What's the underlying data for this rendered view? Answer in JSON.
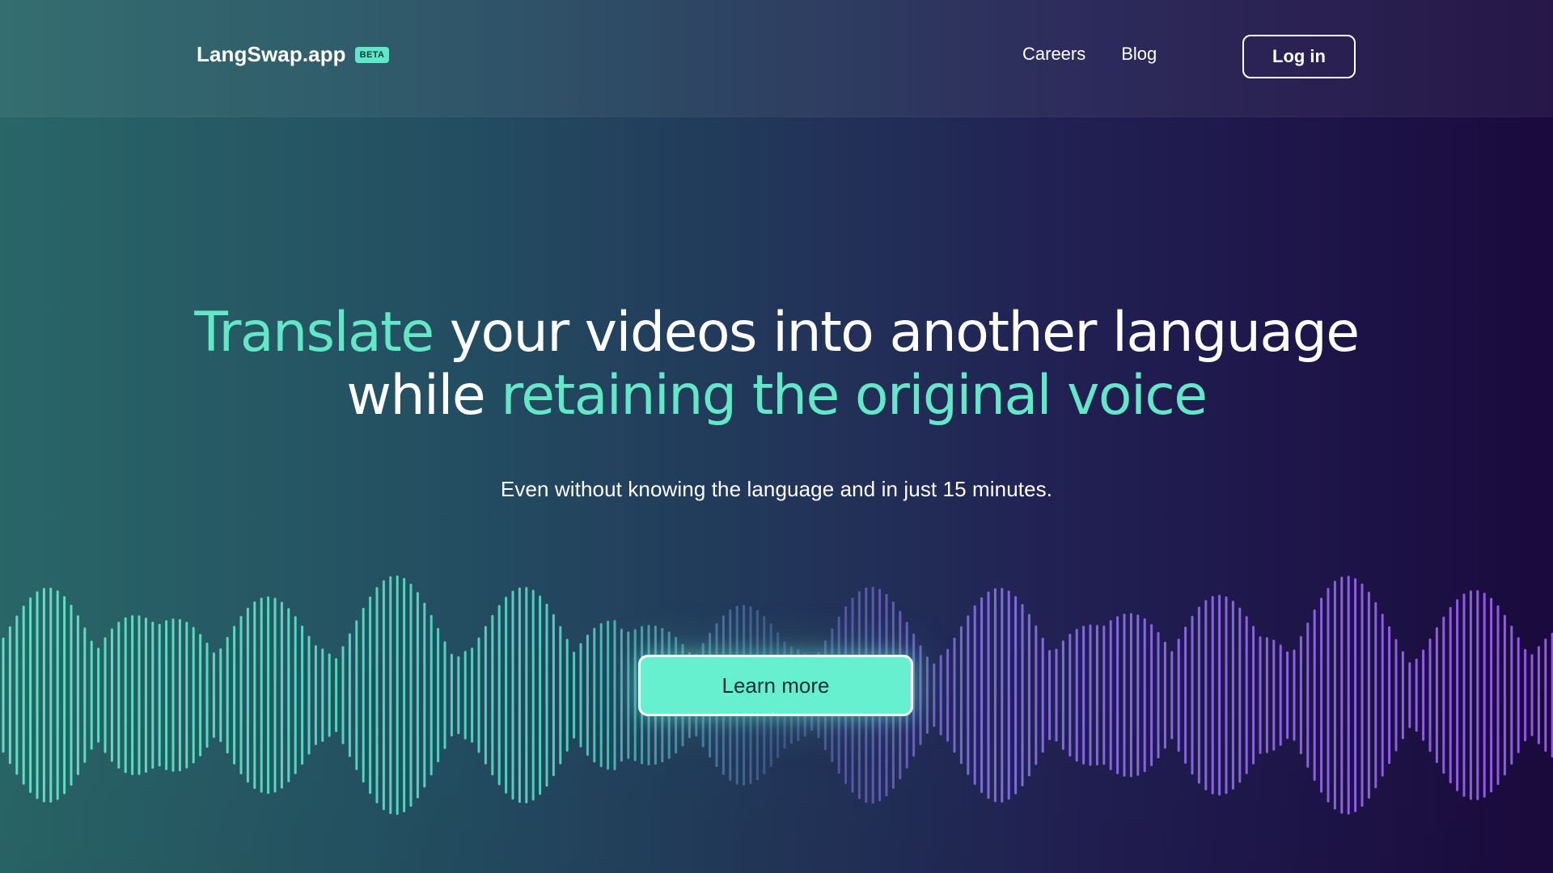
{
  "brand": {
    "name": "LangSwap.app",
    "badge": "BETA"
  },
  "nav": {
    "links": [
      "Careers",
      "Blog"
    ],
    "login_label": "Log in"
  },
  "hero": {
    "title_line1_accent": "Translate",
    "title_line1_rest": " your videos into another language",
    "title_line2_lead": "while ",
    "title_line2_accent": "retaining the original voice",
    "subtitle": "Even without knowing the language and in just 15 minutes."
  },
  "cta": {
    "label": "Learn more"
  },
  "colors": {
    "accent": "#62e8c7",
    "wave_start": "#5fe8c8",
    "wave_end": "#9b5cf2",
    "bg_left": "#296668",
    "bg_right": "#1a0a3d"
  },
  "icons": {
    "waveform": "audio-waveform-decoration"
  }
}
